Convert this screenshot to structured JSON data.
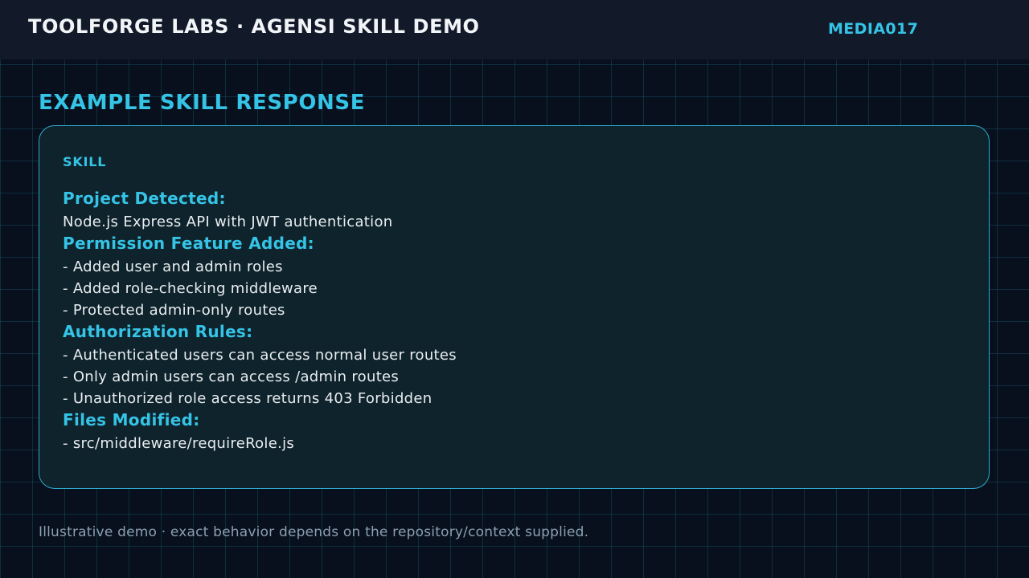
{
  "header": {
    "brand": "TOOLFORGE LABS · AGENSI SKILL DEMO",
    "tag": "MEDIA017"
  },
  "section": {
    "title": "EXAMPLE SKILL RESPONSE"
  },
  "card": {
    "label": "SKILL",
    "groups": [
      {
        "heading": "Project Detected:",
        "lines": [
          "Node.js Express API with JWT authentication"
        ]
      },
      {
        "heading": "Permission Feature Added:",
        "lines": [
          "- Added user and admin roles",
          "- Added role-checking middleware",
          "- Protected admin-only routes"
        ]
      },
      {
        "heading": "Authorization Rules:",
        "lines": [
          "- Authenticated users can access normal user routes",
          "- Only admin users can access /admin routes",
          "- Unauthorized role access returns 403 Forbidden"
        ]
      },
      {
        "heading": "Files Modified:",
        "lines": [
          "- src/middleware/requireRole.js"
        ]
      }
    ]
  },
  "footer": {
    "note": "Illustrative demo · exact behavior depends on the repository/context supplied."
  },
  "colors": {
    "background": "#07101c",
    "header": "#121a2a",
    "accent": "#35c3e6",
    "card": "#0e232b",
    "text": "#e9edf1",
    "muted": "#8d9fb1"
  }
}
